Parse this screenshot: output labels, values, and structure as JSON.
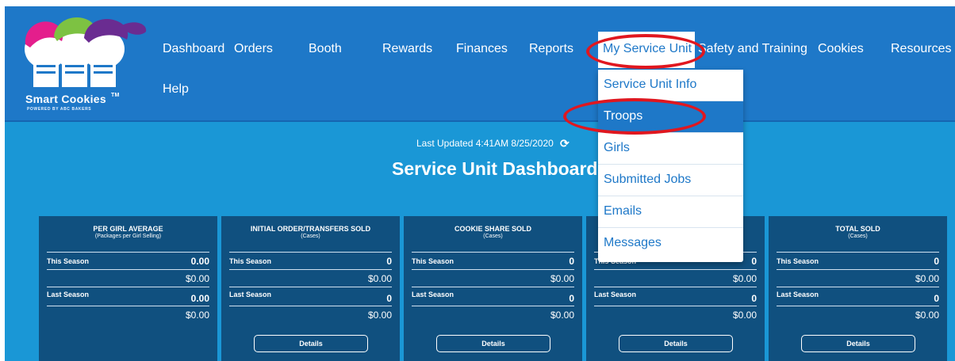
{
  "logo": {
    "text": "Smart Cookies",
    "tm": "TM",
    "sub": "POWERED BY ABC BAKERS"
  },
  "nav": {
    "dashboard": "Dashboard",
    "orders": "Orders",
    "booth": "Booth",
    "rewards": "Rewards",
    "finances": "Finances",
    "reports": "Reports",
    "my_service_unit": "My Service Unit",
    "safety": "Safety and Training",
    "cookies": "Cookies",
    "resources": "Resources",
    "help": "Help"
  },
  "dropdown": {
    "items": [
      {
        "label": "Service Unit Info"
      },
      {
        "label": "Troops",
        "active": true
      },
      {
        "label": "Girls"
      },
      {
        "label": "Submitted Jobs"
      },
      {
        "label": "Emails"
      },
      {
        "label": "Messages"
      }
    ]
  },
  "header": {
    "last_updated": "Last Updated 4:41AM 8/25/2020",
    "refresh_glyph": "⟳",
    "title": "Service Unit Dashboard"
  },
  "cards": [
    {
      "title": "PER GIRL AVERAGE",
      "subtitle": "(Packages per Girl Selling)",
      "this_label": "This Season",
      "this_value": "0.00",
      "this_money": "$0.00",
      "last_label": "Last Season",
      "last_value": "0.00",
      "last_money": "$0.00"
    },
    {
      "title": "INITIAL ORDER/TRANSFERS SOLD",
      "subtitle": "(Cases)",
      "this_label": "This Season",
      "this_value": "0",
      "this_money": "$0.00",
      "last_label": "Last Season",
      "last_value": "0",
      "last_money": "$0.00",
      "button": "Details"
    },
    {
      "title": "COOKIE SHARE SOLD",
      "subtitle": "(Cases)",
      "this_label": "This Season",
      "this_value": "0",
      "this_money": "$0.00",
      "last_label": "Last Season",
      "last_value": "0",
      "last_money": "$0.00",
      "button": "Details"
    },
    {
      "this_label": "This Season",
      "this_value": "0",
      "this_money": "$0.00",
      "last_label": "Last Season",
      "last_value": "0",
      "last_money": "$0.00",
      "button": "Details"
    },
    {
      "title": "TOTAL SOLD",
      "subtitle": "(Cases)",
      "this_label": "This Season",
      "this_value": "0",
      "this_money": "$0.00",
      "last_label": "Last Season",
      "last_value": "0",
      "last_money": "$0.00",
      "button": "Details"
    }
  ],
  "colors": {
    "nav_bg": "#1e78c8",
    "page_bg": "#1a97d6",
    "card_bg": "#10507f",
    "highlight_ring": "#e0171f"
  }
}
